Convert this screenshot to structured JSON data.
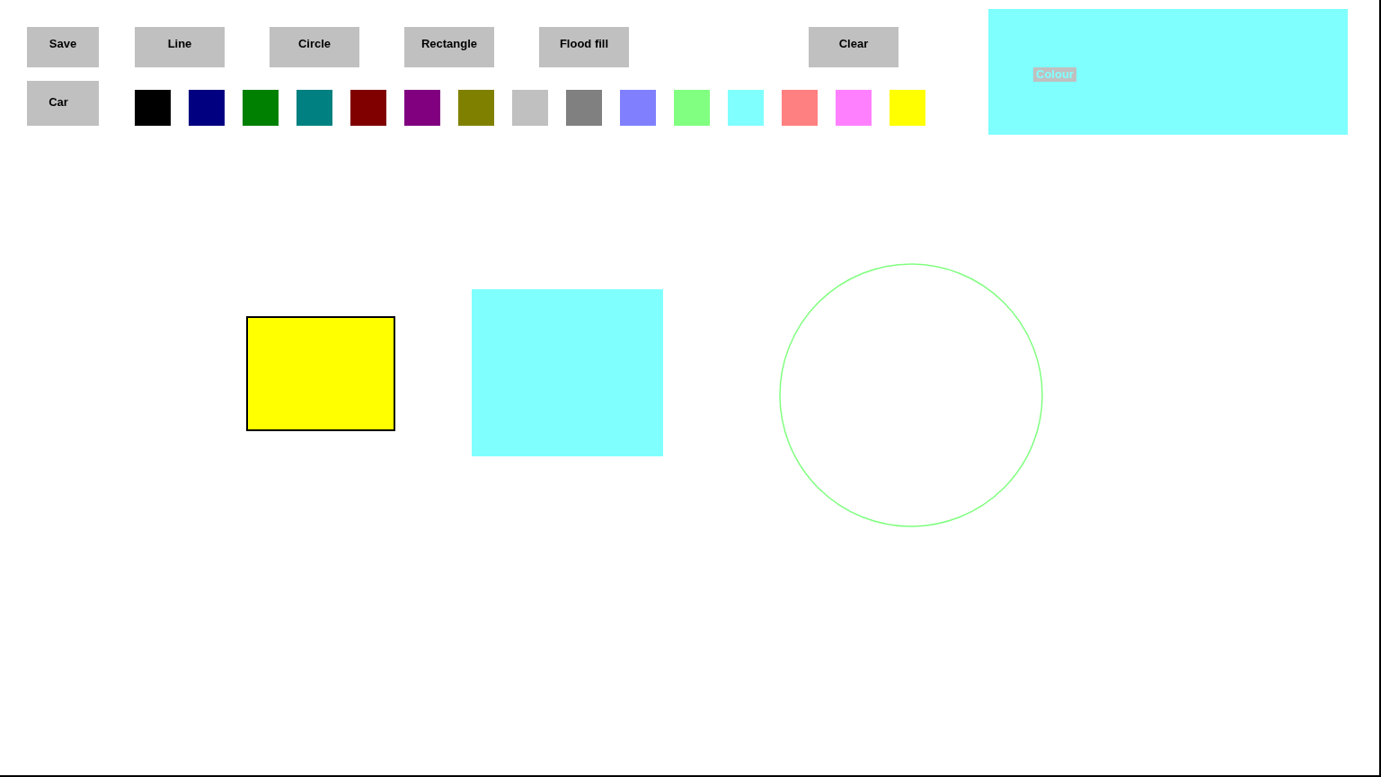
{
  "toolbar": {
    "buttons": [
      "Save",
      "Line",
      "Circle",
      "Rectangle",
      "Flood fill",
      "Clear"
    ],
    "car_button": "Car"
  },
  "palette": [
    {
      "color": "#000000"
    },
    {
      "color": "#000080"
    },
    {
      "color": "#008000"
    },
    {
      "color": "#008080"
    },
    {
      "color": "#800000"
    },
    {
      "color": "#800080"
    },
    {
      "color": "#808000"
    },
    {
      "color": "#c0c0c0"
    },
    {
      "color": "#808080"
    },
    {
      "color": "#8080ff"
    },
    {
      "color": "#80ff80"
    },
    {
      "color": "#80ffff"
    },
    {
      "color": "#ff8080"
    },
    {
      "color": "#ff80ff"
    },
    {
      "color": "#ffff00"
    }
  ],
  "colour_preview": {
    "label": "Colour",
    "color": "#80ffff"
  },
  "canvas": {
    "shapes": [
      {
        "kind": "rectangle",
        "color": "#ffff00",
        "outlined": true
      },
      {
        "kind": "rectangle",
        "color": "#80ffff",
        "outlined": false
      },
      {
        "kind": "circle",
        "color": "#80ff80"
      }
    ]
  }
}
